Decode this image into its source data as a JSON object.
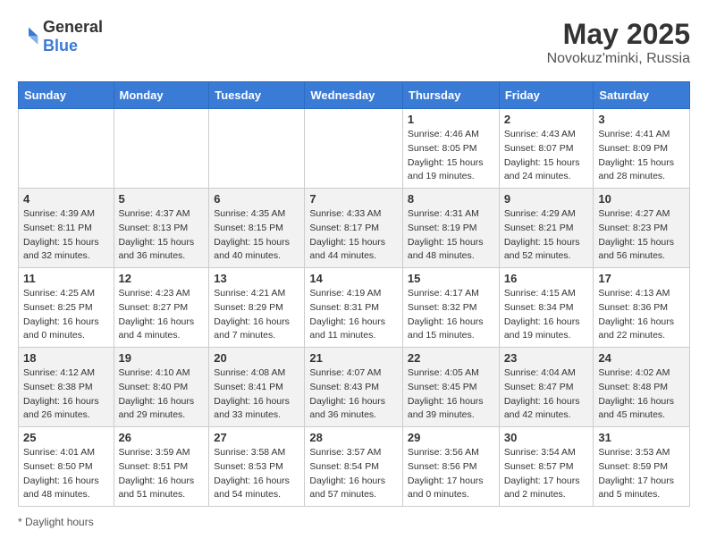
{
  "header": {
    "logo_general": "General",
    "logo_blue": "Blue",
    "title": "May 2025",
    "subtitle": "Novokuz'minki, Russia"
  },
  "days_of_week": [
    "Sunday",
    "Monday",
    "Tuesday",
    "Wednesday",
    "Thursday",
    "Friday",
    "Saturday"
  ],
  "weeks": [
    [
      {
        "day": "",
        "info": ""
      },
      {
        "day": "",
        "info": ""
      },
      {
        "day": "",
        "info": ""
      },
      {
        "day": "",
        "info": ""
      },
      {
        "day": "1",
        "info": "Sunrise: 4:46 AM\nSunset: 8:05 PM\nDaylight: 15 hours\nand 19 minutes."
      },
      {
        "day": "2",
        "info": "Sunrise: 4:43 AM\nSunset: 8:07 PM\nDaylight: 15 hours\nand 24 minutes."
      },
      {
        "day": "3",
        "info": "Sunrise: 4:41 AM\nSunset: 8:09 PM\nDaylight: 15 hours\nand 28 minutes."
      }
    ],
    [
      {
        "day": "4",
        "info": "Sunrise: 4:39 AM\nSunset: 8:11 PM\nDaylight: 15 hours\nand 32 minutes."
      },
      {
        "day": "5",
        "info": "Sunrise: 4:37 AM\nSunset: 8:13 PM\nDaylight: 15 hours\nand 36 minutes."
      },
      {
        "day": "6",
        "info": "Sunrise: 4:35 AM\nSunset: 8:15 PM\nDaylight: 15 hours\nand 40 minutes."
      },
      {
        "day": "7",
        "info": "Sunrise: 4:33 AM\nSunset: 8:17 PM\nDaylight: 15 hours\nand 44 minutes."
      },
      {
        "day": "8",
        "info": "Sunrise: 4:31 AM\nSunset: 8:19 PM\nDaylight: 15 hours\nand 48 minutes."
      },
      {
        "day": "9",
        "info": "Sunrise: 4:29 AM\nSunset: 8:21 PM\nDaylight: 15 hours\nand 52 minutes."
      },
      {
        "day": "10",
        "info": "Sunrise: 4:27 AM\nSunset: 8:23 PM\nDaylight: 15 hours\nand 56 minutes."
      }
    ],
    [
      {
        "day": "11",
        "info": "Sunrise: 4:25 AM\nSunset: 8:25 PM\nDaylight: 16 hours\nand 0 minutes."
      },
      {
        "day": "12",
        "info": "Sunrise: 4:23 AM\nSunset: 8:27 PM\nDaylight: 16 hours\nand 4 minutes."
      },
      {
        "day": "13",
        "info": "Sunrise: 4:21 AM\nSunset: 8:29 PM\nDaylight: 16 hours\nand 7 minutes."
      },
      {
        "day": "14",
        "info": "Sunrise: 4:19 AM\nSunset: 8:31 PM\nDaylight: 16 hours\nand 11 minutes."
      },
      {
        "day": "15",
        "info": "Sunrise: 4:17 AM\nSunset: 8:32 PM\nDaylight: 16 hours\nand 15 minutes."
      },
      {
        "day": "16",
        "info": "Sunrise: 4:15 AM\nSunset: 8:34 PM\nDaylight: 16 hours\nand 19 minutes."
      },
      {
        "day": "17",
        "info": "Sunrise: 4:13 AM\nSunset: 8:36 PM\nDaylight: 16 hours\nand 22 minutes."
      }
    ],
    [
      {
        "day": "18",
        "info": "Sunrise: 4:12 AM\nSunset: 8:38 PM\nDaylight: 16 hours\nand 26 minutes."
      },
      {
        "day": "19",
        "info": "Sunrise: 4:10 AM\nSunset: 8:40 PM\nDaylight: 16 hours\nand 29 minutes."
      },
      {
        "day": "20",
        "info": "Sunrise: 4:08 AM\nSunset: 8:41 PM\nDaylight: 16 hours\nand 33 minutes."
      },
      {
        "day": "21",
        "info": "Sunrise: 4:07 AM\nSunset: 8:43 PM\nDaylight: 16 hours\nand 36 minutes."
      },
      {
        "day": "22",
        "info": "Sunrise: 4:05 AM\nSunset: 8:45 PM\nDaylight: 16 hours\nand 39 minutes."
      },
      {
        "day": "23",
        "info": "Sunrise: 4:04 AM\nSunset: 8:47 PM\nDaylight: 16 hours\nand 42 minutes."
      },
      {
        "day": "24",
        "info": "Sunrise: 4:02 AM\nSunset: 8:48 PM\nDaylight: 16 hours\nand 45 minutes."
      }
    ],
    [
      {
        "day": "25",
        "info": "Sunrise: 4:01 AM\nSunset: 8:50 PM\nDaylight: 16 hours\nand 48 minutes."
      },
      {
        "day": "26",
        "info": "Sunrise: 3:59 AM\nSunset: 8:51 PM\nDaylight: 16 hours\nand 51 minutes."
      },
      {
        "day": "27",
        "info": "Sunrise: 3:58 AM\nSunset: 8:53 PM\nDaylight: 16 hours\nand 54 minutes."
      },
      {
        "day": "28",
        "info": "Sunrise: 3:57 AM\nSunset: 8:54 PM\nDaylight: 16 hours\nand 57 minutes."
      },
      {
        "day": "29",
        "info": "Sunrise: 3:56 AM\nSunset: 8:56 PM\nDaylight: 17 hours\nand 0 minutes."
      },
      {
        "day": "30",
        "info": "Sunrise: 3:54 AM\nSunset: 8:57 PM\nDaylight: 17 hours\nand 2 minutes."
      },
      {
        "day": "31",
        "info": "Sunrise: 3:53 AM\nSunset: 8:59 PM\nDaylight: 17 hours\nand 5 minutes."
      }
    ]
  ],
  "footer": {
    "note": "Daylight hours"
  }
}
